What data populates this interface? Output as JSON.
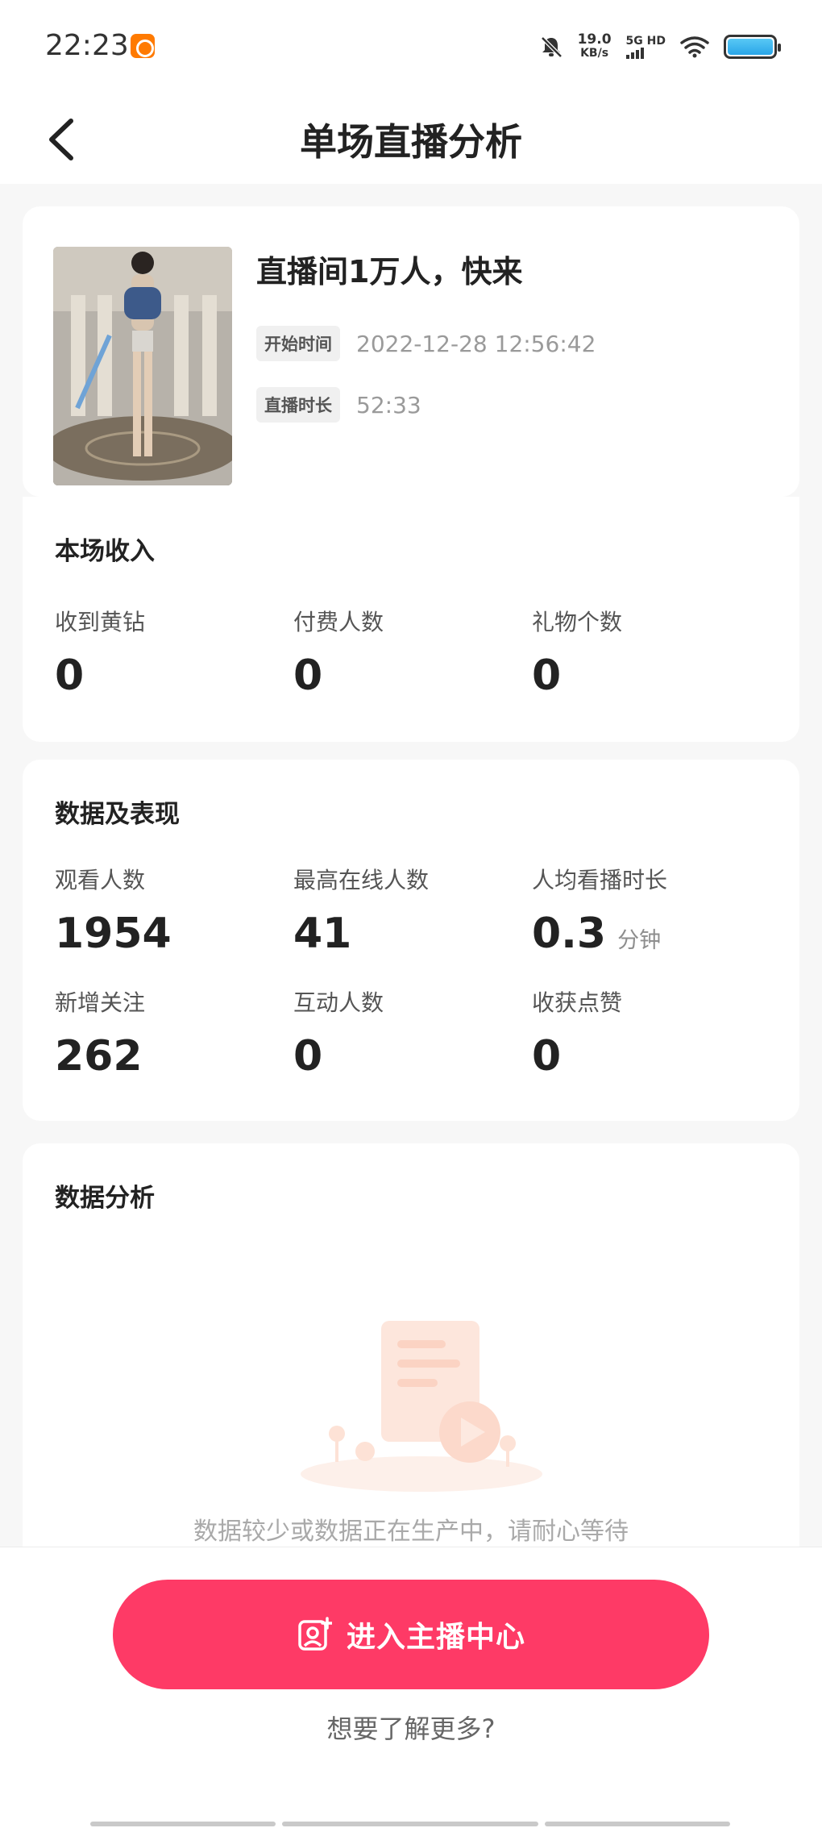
{
  "status_bar": {
    "time": "22:23",
    "net_speed_value": "19.0",
    "net_speed_unit": "KB/s",
    "network_label": "5G HD",
    "icons": [
      "app-notification-icon",
      "bell-off-icon",
      "signal-icon",
      "wifi-icon",
      "battery-icon"
    ],
    "battery_color": "#2aa6e8"
  },
  "header": {
    "title": "单场直播分析",
    "back_icon": "chevron-left-icon"
  },
  "live_info": {
    "title": "直播间1万人，快来",
    "start_time_tag": "开始时间",
    "start_time": "2022-12-28 12:56:42",
    "duration_tag": "直播时长",
    "duration": "52:33"
  },
  "income": {
    "title": "本场收入",
    "stats": [
      {
        "label": "收到黄钻",
        "value": "0"
      },
      {
        "label": "付费人数",
        "value": "0"
      },
      {
        "label": "礼物个数",
        "value": "0"
      }
    ]
  },
  "performance": {
    "title": "数据及表现",
    "stats": [
      {
        "label": "观看人数",
        "value": "1954",
        "unit": ""
      },
      {
        "label": "最高在线人数",
        "value": "41",
        "unit": ""
      },
      {
        "label": "人均看播时长",
        "value": "0.3",
        "unit": "分钟"
      },
      {
        "label": "新增关注",
        "value": "262",
        "unit": ""
      },
      {
        "label": "互动人数",
        "value": "0",
        "unit": ""
      },
      {
        "label": "收获点赞",
        "value": "0",
        "unit": ""
      }
    ]
  },
  "analysis": {
    "title": "数据分析",
    "empty_message": "数据较少或数据正在生产中，请耐心等待",
    "empty_icon": "document-video-icon"
  },
  "bottom": {
    "cta_label": "进入主播中心",
    "cta_icon": "user-add-icon",
    "learn_more": "想要了解更多?",
    "accent_color": "#fe3a66"
  }
}
